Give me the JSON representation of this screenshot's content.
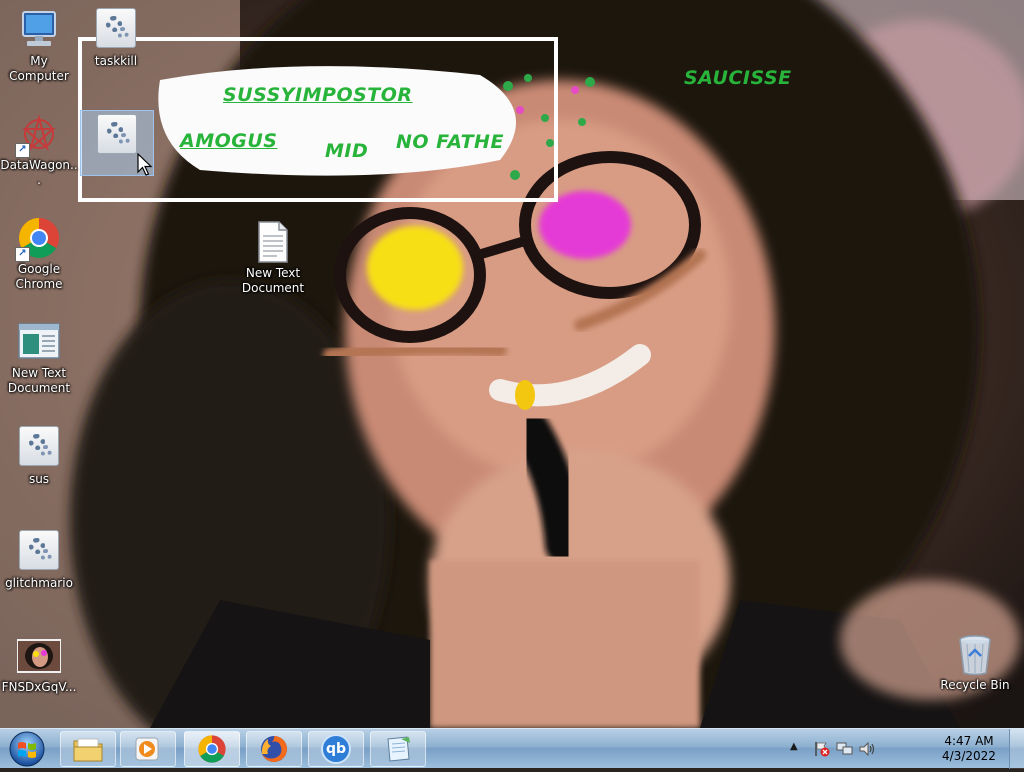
{
  "desktop": {
    "icons": [
      {
        "label": "My Computer",
        "icon": "computer-icon"
      },
      {
        "label": "taskkill",
        "icon": "gear-app-icon"
      },
      {
        "label": "DataWagon...",
        "icon": "datawagon-icon"
      },
      {
        "label": "Google Chrome",
        "icon": "chrome-icon"
      },
      {
        "label": "New Text Document",
        "icon": "text-document-icon"
      },
      {
        "label": "New Text Document",
        "icon": "notepad-window-icon"
      },
      {
        "label": "sus",
        "icon": "gear-app-icon"
      },
      {
        "label": "glitchmario",
        "icon": "gear-app-icon"
      },
      {
        "label": "FNSDxGqV...",
        "icon": "image-thumbnail-icon"
      },
      {
        "label": "Recycle Bin",
        "icon": "recycle-bin-icon"
      }
    ],
    "selected_icon": "gear-app-icon"
  },
  "wallpaper_text": {
    "line1": "SUSSYIMPOSTOR",
    "line2": "AMOGUS",
    "line3": "MID",
    "line4": "NO FATHE",
    "corner": "SAUCISSE",
    "text_color": "#28b43a"
  },
  "taskbar": {
    "buttons": [
      {
        "name": "start-button",
        "icon": "windows-orb-icon"
      },
      {
        "name": "explorer",
        "icon": "folder-icon"
      },
      {
        "name": "media-player",
        "icon": "media-player-icon"
      },
      {
        "name": "chrome",
        "icon": "chrome-icon",
        "active": true
      },
      {
        "name": "firefox",
        "icon": "firefox-icon"
      },
      {
        "name": "qbittorrent",
        "icon": "qbittorrent-icon",
        "glyph": "qb"
      },
      {
        "name": "notepad",
        "icon": "notepad-icon"
      }
    ],
    "tray": {
      "chevron": "▲",
      "time": "4:47 AM",
      "date": "4/3/2022"
    }
  },
  "colors": {
    "taskbar": "#8db0d0",
    "selection": "#9cc3ee",
    "magenta_paint": "#e53ad6",
    "yellow_paint": "#f7df12"
  }
}
